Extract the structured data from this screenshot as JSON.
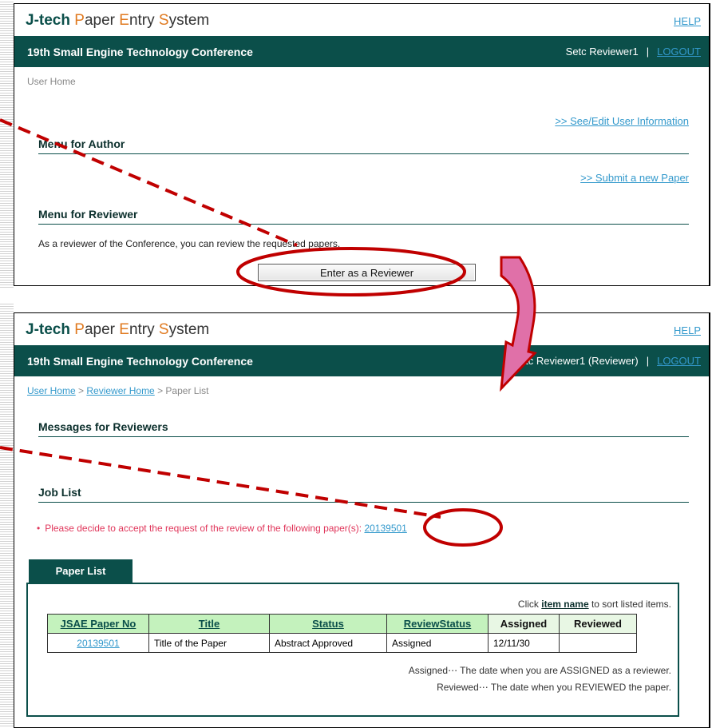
{
  "brand": {
    "part1": "J-tech",
    "p": "P",
    "aper": "aper ",
    "e": "E",
    "ntry": "ntry ",
    "s": "S",
    "ystem": "ystem"
  },
  "help_label": "HELP",
  "conference_title": "19th Small Engine Technology Conference",
  "logout_label": "LOGOUT",
  "panel1": {
    "user": "Setc Reviewer1",
    "sep": "|",
    "breadcrumb": "User Home",
    "see_edit_link": ">> See/Edit User Information",
    "menu_author_title": "Menu for Author",
    "submit_link": ">> Submit a new Paper",
    "menu_reviewer_title": "Menu for Reviewer",
    "reviewer_text": "As a reviewer of the Conference, you can review the requested papers.",
    "enter_button": "Enter as a Reviewer"
  },
  "panel2": {
    "user": "Setc Reviewer1 (Reviewer)",
    "sep": "|",
    "breadcrumb": {
      "home": "User Home",
      "sep1": " > ",
      "reviewer_home": "Reviewer Home",
      "sep2": " > ",
      "current": "Paper List"
    },
    "messages_title": "Messages for Reviewers",
    "job_list_title": "Job List",
    "job_message": "Please decide to accept the request of the review of the following paper(s):",
    "job_paper_link": "20139501",
    "tab_label": "Paper List",
    "sort_hint_pre": "Click ",
    "sort_hint_bold": "item name",
    "sort_hint_post": " to sort listed items.",
    "table": {
      "headers": [
        "JSAE Paper No",
        "Title",
        "Status",
        "ReviewStatus",
        "Assigned",
        "Reviewed"
      ],
      "rows": [
        {
          "paper_no": "20139501",
          "title": "Title of the Paper",
          "status": "Abstract Approved",
          "review_status": "Assigned",
          "assigned": "12/11/30",
          "reviewed": ""
        }
      ]
    },
    "note_assigned": "Assigned⋯ The date when you are ASSIGNED as a reviewer.",
    "note_reviewed": "Reviewed⋯ The date when you REVIEWED the paper."
  },
  "colors": {
    "brand_teal": "#0b4f4a",
    "link_blue": "#3399cc",
    "annotation_red": "#c00000",
    "arrow_pink": "#e070a8",
    "message_red": "#e0355a"
  }
}
